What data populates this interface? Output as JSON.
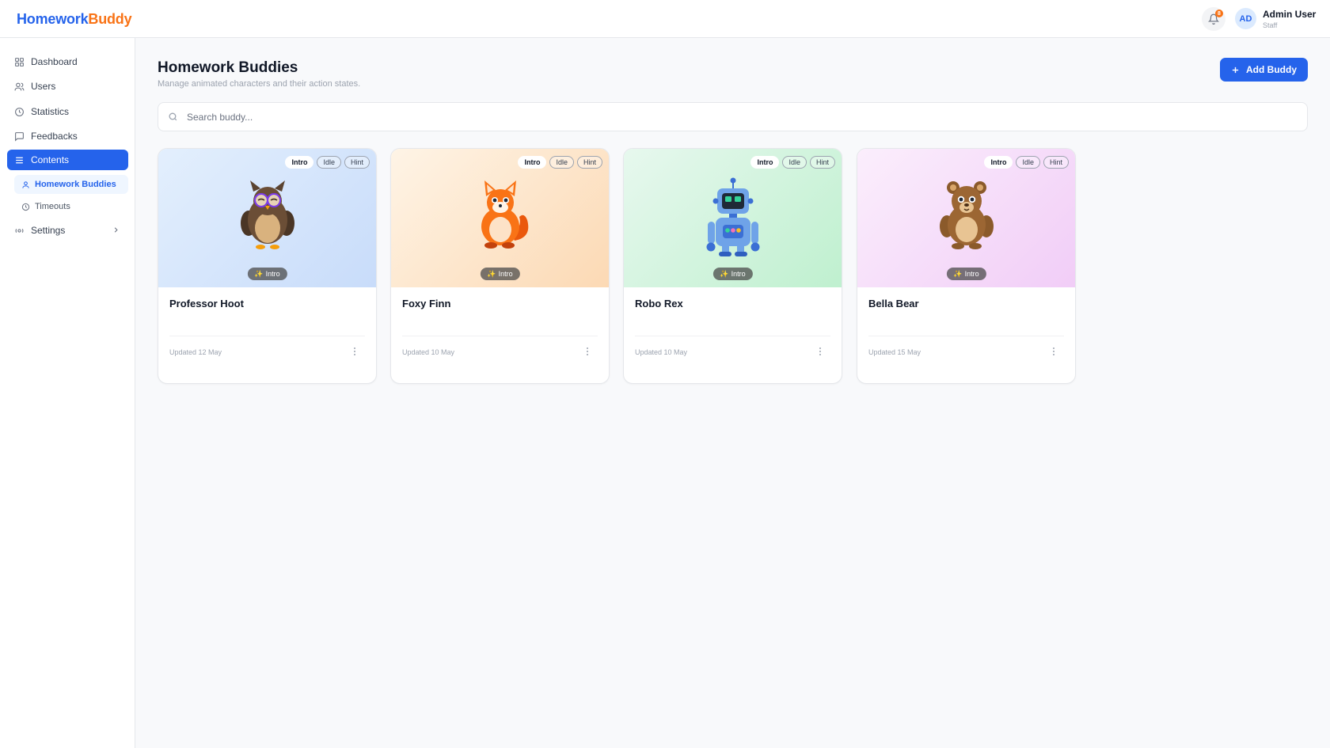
{
  "app": {
    "logo_part1": "Homework",
    "logo_part2": "Buddy"
  },
  "header": {
    "notification_count": "8",
    "avatar_initials": "AD",
    "user_name": "Admin User",
    "user_role": "Staff"
  },
  "sidebar": {
    "items": [
      {
        "label": "Dashboard",
        "icon": "grid-icon"
      },
      {
        "label": "Users",
        "icon": "users-icon"
      },
      {
        "label": "Statistics",
        "icon": "clock-icon"
      },
      {
        "label": "Feedbacks",
        "icon": "message-icon"
      },
      {
        "label": "Contents",
        "icon": "menu-icon",
        "active": true
      },
      {
        "label": "Homework Buddies",
        "icon": "person-icon",
        "active": true
      },
      {
        "label": "Timeouts",
        "icon": "clock-icon"
      },
      {
        "label": "Settings",
        "icon": "settings-icon"
      }
    ]
  },
  "main": {
    "title": "Homework Buddies",
    "subtitle": "Manage animated characters and their action states.",
    "add_button": "Add Buddy",
    "search_placeholder": "Search buddy..."
  },
  "chips": {
    "intro": "Intro",
    "idle": "Idle",
    "hint": "Hint"
  },
  "cards": [
    {
      "name": "Professor Hoot",
      "state": "Intro",
      "updated": "Updated 12 May",
      "character": "owl",
      "bg_from": "#e3effd",
      "bg_to": "#c8dcfa"
    },
    {
      "name": "Foxy Finn",
      "state": "Intro",
      "updated": "Updated 10 May",
      "character": "fox",
      "bg_from": "#fef4e6",
      "bg_to": "#fcd9b4"
    },
    {
      "name": "Robo Rex",
      "state": "Intro",
      "updated": "Updated 10 May",
      "character": "robot",
      "bg_from": "#e7f8ee",
      "bg_to": "#bff0cf"
    },
    {
      "name": "Bella Bear",
      "state": "Intro",
      "updated": "Updated 15 May",
      "character": "bear",
      "bg_from": "#fbeefc",
      "bg_to": "#f1cdf7"
    }
  ],
  "colors": {
    "accent": "#2563eb",
    "brand_orange": "#f97316"
  }
}
